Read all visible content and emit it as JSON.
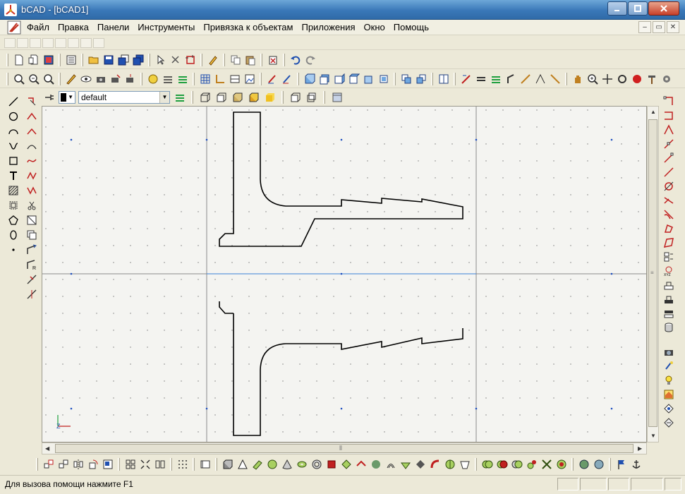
{
  "window": {
    "title": "bCAD - [bCAD1]"
  },
  "menubar": {
    "items": [
      "Файл",
      "Правка",
      "Панели",
      "Инструменты",
      "Привязка к объектам",
      "Приложения",
      "Окно",
      "Помощь"
    ]
  },
  "properties_bar": {
    "color": "#000000",
    "layer_value": "default"
  },
  "statusbar": {
    "help_text": "Для вызова помощи нажмите F1"
  },
  "icons": {
    "toolbar1": [
      "new-icon",
      "new-window-icon",
      "print-preview-icon",
      "list-icon",
      "open-icon",
      "save-icon",
      "save-as-icon",
      "save-all-icon",
      "select-icon",
      "cut-selection-icon",
      "crop-icon",
      "edit-icon",
      "copy-icon",
      "paste-icon",
      "undo-icon",
      "redo-icon"
    ],
    "left_tools": [
      "line-icon",
      "circle-icon",
      "arc-icon",
      "spline-icon",
      "rectangle-icon",
      "text-icon",
      "hatch-icon",
      "block-icon",
      "polygon-icon",
      "ellipse-icon",
      "point-icon"
    ]
  },
  "colors": {
    "accent": "#3a78b8",
    "axis_line": "#3a7fd8",
    "drawing": "#000000"
  }
}
